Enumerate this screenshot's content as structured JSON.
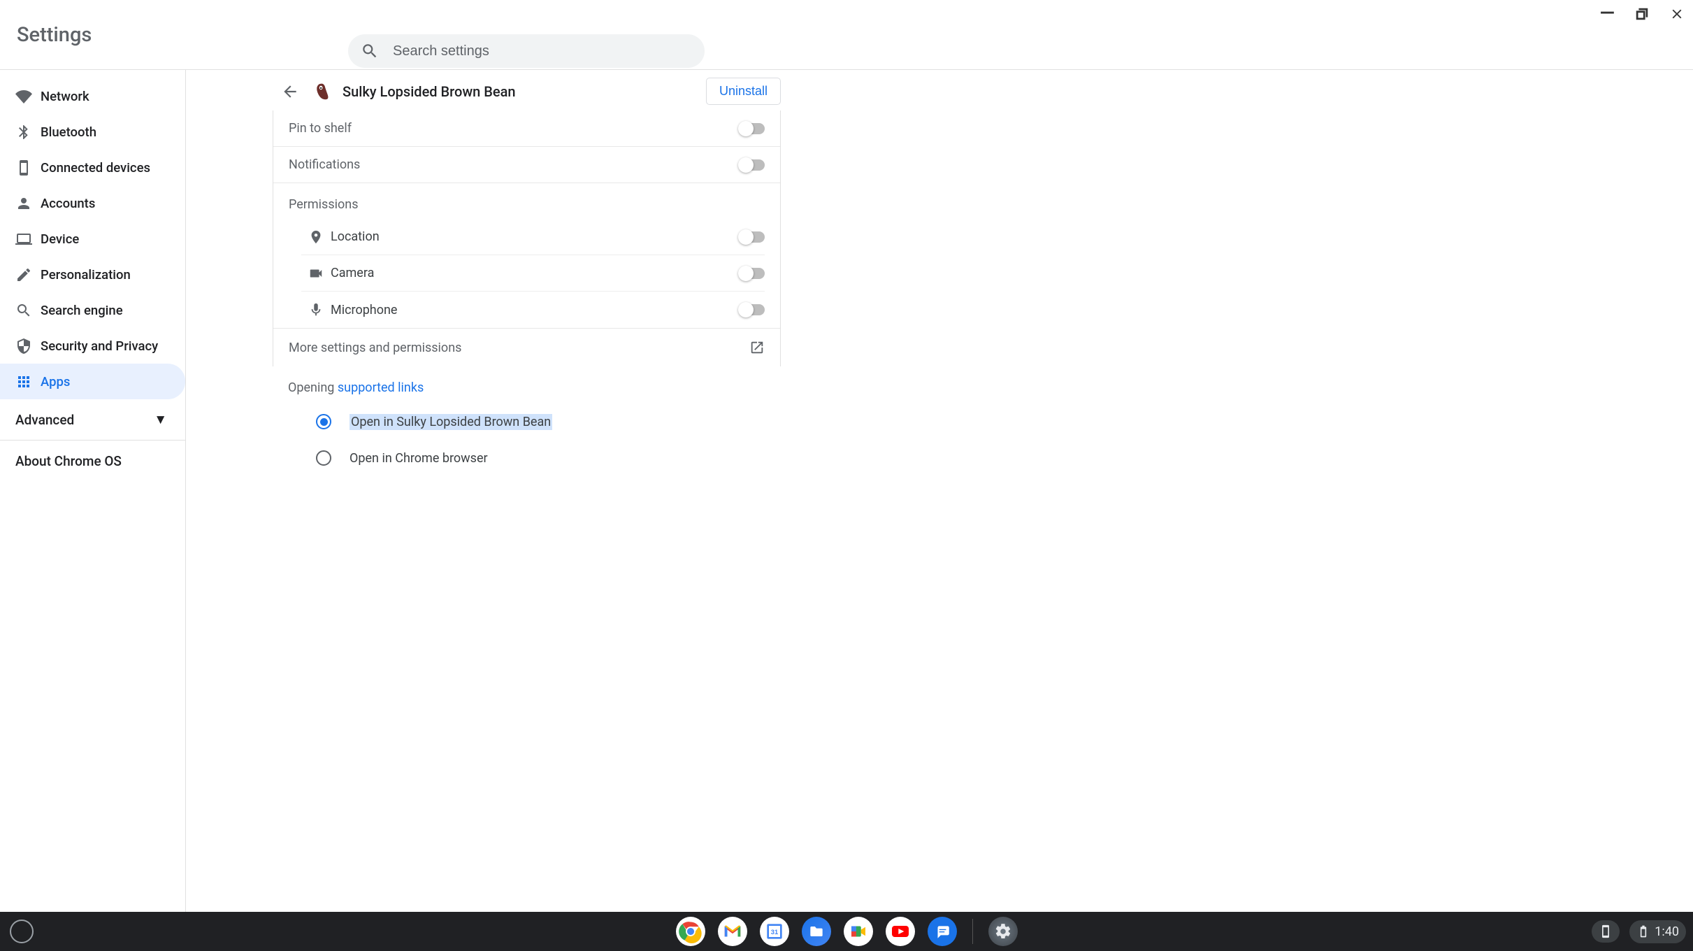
{
  "app_title": "Settings",
  "search": {
    "placeholder": "Search settings"
  },
  "sidebar": {
    "items": [
      {
        "label": "Network"
      },
      {
        "label": "Bluetooth"
      },
      {
        "label": "Connected devices"
      },
      {
        "label": "Accounts"
      },
      {
        "label": "Device"
      },
      {
        "label": "Personalization"
      },
      {
        "label": "Search engine"
      },
      {
        "label": "Security and Privacy"
      },
      {
        "label": "Apps"
      }
    ],
    "advanced": "Advanced",
    "about": "About Chrome OS"
  },
  "detail": {
    "app_name": "Sulky Lopsided Brown Bean",
    "uninstall": "Uninstall",
    "pin_to_shelf": "Pin to shelf",
    "notifications": "Notifications",
    "permissions_label": "Permissions",
    "permissions": [
      {
        "label": "Location"
      },
      {
        "label": "Camera"
      },
      {
        "label": "Microphone"
      }
    ],
    "more_settings": "More settings and permissions",
    "opening_prefix": "Opening ",
    "opening_link": "supported links",
    "radio1": "Open in Sulky Lopsided Brown Bean",
    "radio2": "Open in Chrome browser"
  },
  "shelf": {
    "time": "1:40"
  }
}
